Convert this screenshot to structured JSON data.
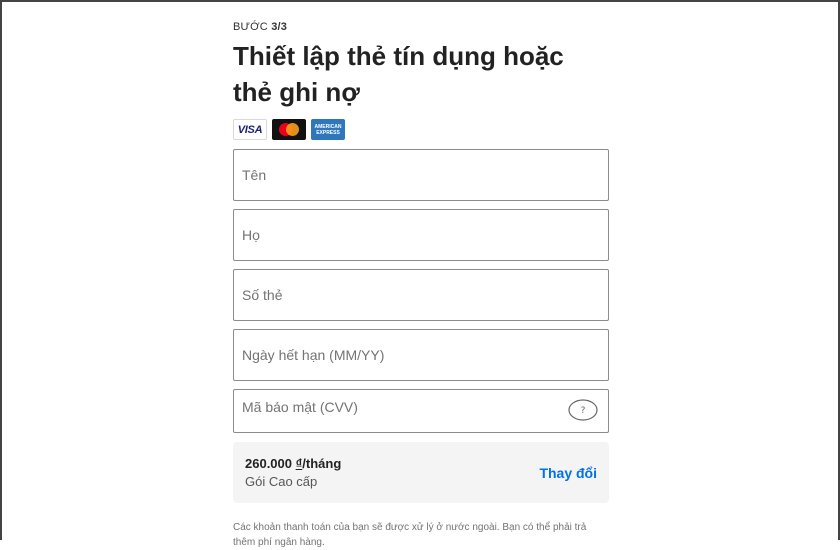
{
  "header": {
    "step_prefix": "BƯỚC",
    "step_value": "3/3",
    "title": "Thiết lập thẻ tín dụng hoặc thẻ ghi nợ"
  },
  "card_logos": [
    {
      "name": "visa-logo",
      "label": "VISA"
    },
    {
      "name": "mastercard-logo",
      "label": "mastercard"
    },
    {
      "name": "amex-logo",
      "label": "AMERICAN EXPRESS"
    }
  ],
  "form": {
    "first_name_placeholder": "Tên",
    "last_name_placeholder": "Họ",
    "card_number_placeholder": "Số thẻ",
    "expiry_placeholder": "Ngày hết hạn (MM/YY)",
    "cvv_placeholder": "Mã bảo mật (CVV)",
    "cvv_help_icon": "question-mark-icon"
  },
  "plan": {
    "price": "260.000",
    "currency": "₫",
    "period": "/tháng",
    "name": "Gói Cao cấp",
    "change_label": "Thay đổi"
  },
  "footer": {
    "note": "Các khoản thanh toán của bạn sẽ được xử lý ở nước ngoài. Bạn có thể phải trả thêm phí ngân hàng."
  },
  "colors": {
    "link": "#0071eb",
    "border": "#8c8c8c",
    "plan_bg": "#f4f4f4",
    "placeholder": "#737373"
  }
}
